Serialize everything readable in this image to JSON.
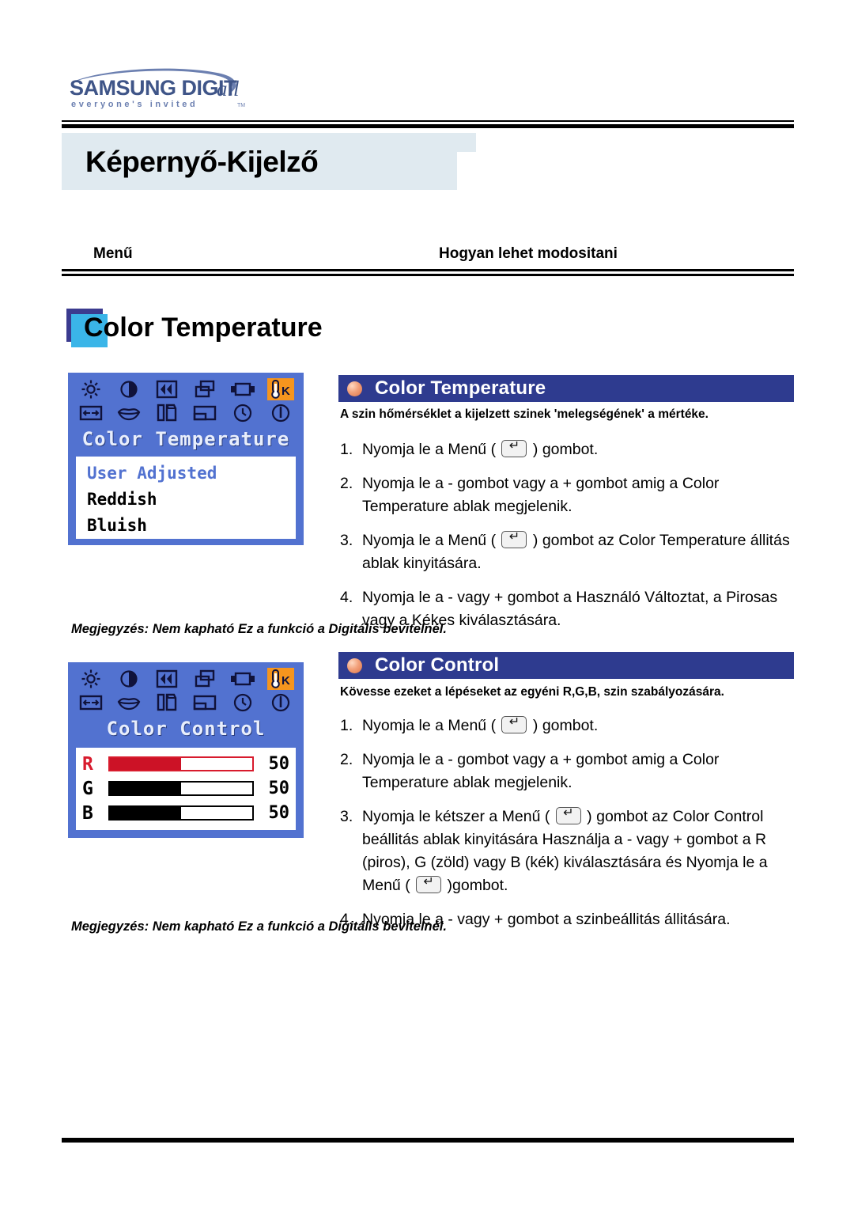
{
  "brand": {
    "name": "SAMSUNG DIGITall",
    "tagline": "everyone's invited",
    "trademark": "TM"
  },
  "header": {
    "page_title": "Képernyő-Kijelző",
    "column_menu": "Menű",
    "column_how": "Hogyan lehet modositani"
  },
  "section": {
    "title": "Color Temperature",
    "chip_color": "#3ab5e8",
    "chip_shadow_color": "#3b3b8f"
  },
  "osd_temperature": {
    "caption": "Color Temperature",
    "background": "#5272d0",
    "selected_icon": "temperature-k-icon",
    "selected_icon_color": "#f6951e",
    "icons_row1": [
      "brightness-icon",
      "contrast-icon",
      "image-lock-icon",
      "position-icon",
      "frame-icon",
      "temperature-k-icon"
    ],
    "icons_row2": [
      "image-size-icon",
      "lips-icon",
      "sharpness-icon",
      "osd-position-icon",
      "timer-icon",
      "information-icon"
    ],
    "items": [
      {
        "label": "User Adjusted",
        "active": true
      },
      {
        "label": "Reddish",
        "active": false
      },
      {
        "label": "Bluish",
        "active": false
      }
    ]
  },
  "osd_control": {
    "caption": "Color Control",
    "background": "#5272d0",
    "selected_icon": "temperature-k-icon",
    "icons_row1": [
      "brightness-icon",
      "contrast-icon",
      "image-lock-icon",
      "position-icon",
      "frame-icon",
      "temperature-k-icon"
    ],
    "icons_row2": [
      "image-size-icon",
      "lips-icon",
      "sharpness-icon",
      "osd-position-icon",
      "timer-icon",
      "information-icon"
    ],
    "rows": [
      {
        "channel": "R",
        "value": "50",
        "percent": 50,
        "color": "#cc1226",
        "highlighted": true
      },
      {
        "channel": "G",
        "value": "50",
        "percent": 50,
        "color": "#000000",
        "highlighted": false
      },
      {
        "channel": "B",
        "value": "50",
        "percent": 50,
        "color": "#000000",
        "highlighted": false
      }
    ]
  },
  "panel_temperature": {
    "bar_label": "Color Temperature",
    "bar_color": "#2e3b8f",
    "description": "A szin hőmérséklet a kijelzett szinek 'melegségének' a mértéke.",
    "steps": [
      {
        "num": "1.",
        "before": "Nyomja le a Menű  ( ",
        "after": " ) gombot.",
        "has_key": true
      },
      {
        "num": "2.",
        "before": "Nyomja le a - gombot vagy a + gombot amig a Color Temperature ablak megjelenik.",
        "after": "",
        "has_key": false
      },
      {
        "num": "3.",
        "before": "Nyomja le a Menű ( ",
        "after": " ) gombot az Color Temperature állitás ablak kinyitására.",
        "has_key": true
      },
      {
        "num": "4.",
        "before": "Nyomja le a - vagy + gombot a Használó Változtat, a Pirosas vagy a Kékes kiválasztására.",
        "after": "",
        "has_key": false
      }
    ],
    "memo": "Megjegyzés: Nem kapható Ez a funkció a Digitális bevitelnél."
  },
  "panel_control": {
    "bar_label": "Color Control",
    "bar_color": "#2e3b8f",
    "description": "Kövesse ezeket a lépéseket az egyéni R,G,B, szin szabályozására.",
    "steps": [
      {
        "num": "1.",
        "before": "Nyomja le a Menű  ( ",
        "after": " ) gombot.",
        "has_key": true
      },
      {
        "num": "2.",
        "before": "Nyomja le a - gombot vagy a + gombot amig a Color Temperature ablak megjelenik.",
        "after": "",
        "has_key": false
      },
      {
        "num": "3.",
        "before": "Nyomja le kétszer a Menű ( ",
        "mid": " ) gombot az Color Control beállitás ablak kinyitására Használja a - vagy + gombot a R (piros), G (zöld) vagy B (kék) kiválasztására és Nyomja le a Menű ( ",
        "after": " )gombot.",
        "has_key": true,
        "has_key2": true
      },
      {
        "num": "4.",
        "before": "Nyomja le a - vagy + gombot a szinbeállitás állitására.",
        "after": "",
        "has_key": false
      }
    ],
    "memo": "Megjegyzés: Nem kapható Ez a funkció a Digitális bevitelnél."
  }
}
